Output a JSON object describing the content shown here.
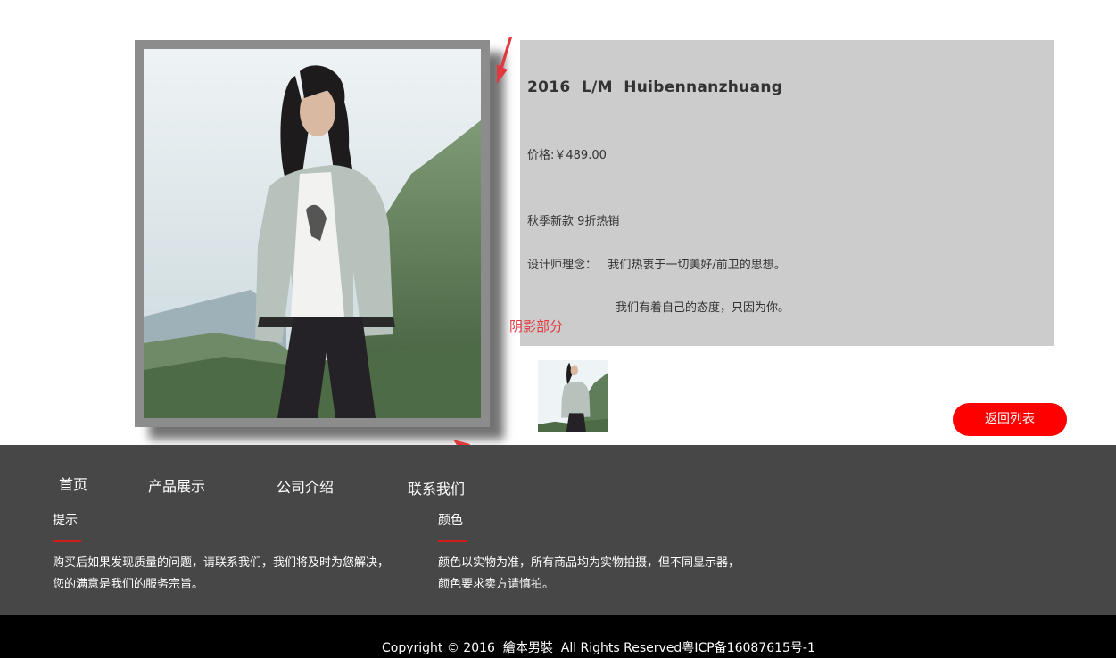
{
  "product": {
    "title": "2016  L/M  Huibennanzhuang",
    "price_line": "价格:￥489.00",
    "promo_line": "秋季新款 9折热销",
    "concept_line": "设计师理念：   我们热衷于一切美好/前卫的思想。",
    "concept_line2": "我们有着自己的态度，只因为你。",
    "panel_bg": "#cccccc"
  },
  "back_button_label": "返回列表",
  "annotation": {
    "shadow_label": "阴影部分",
    "color": "#e0393f"
  },
  "footer": {
    "nav": [
      "首页",
      "产品展示",
      "公司介绍",
      "联系我们"
    ],
    "tips": {
      "heading": "提示",
      "text": "购买后如果发现质量的问题，请联系我们，我们将及时为您解决，\n您的满意是我们的服务宗旨。"
    },
    "color": {
      "heading": "颜色",
      "text": "颜色以实物为准，所有商品均为实物拍摄，但不同显示器，\n颜色要求卖方请慎拍。"
    },
    "bg": "#474747",
    "accent": "#d41c1c"
  },
  "copyright": "Copyright © 2016  繪本男裝  All Rights Reserved粤ICP备16087615号-1",
  "colors": {
    "button": "#ff0000",
    "frame": "#8c8c8c"
  }
}
